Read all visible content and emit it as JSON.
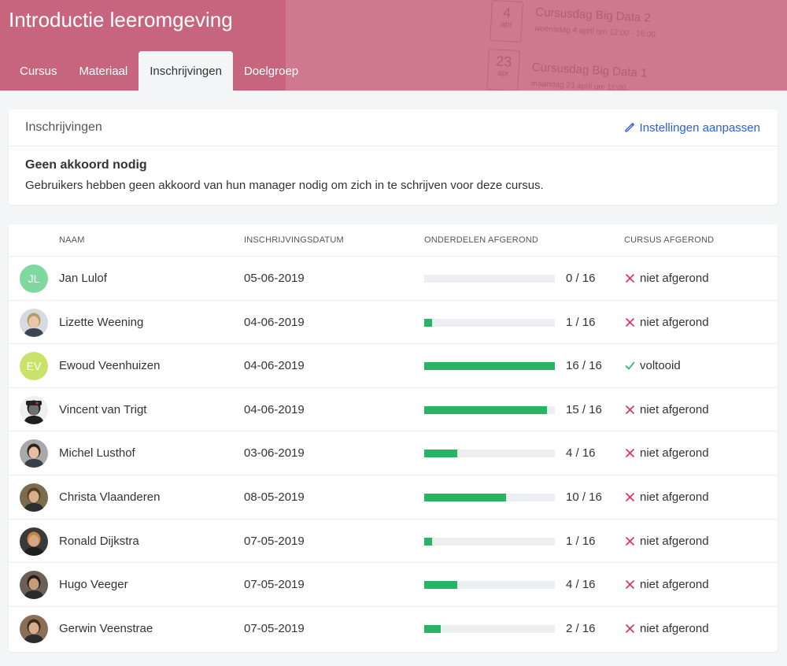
{
  "header": {
    "title": "Introductie leeromgeving",
    "background_events": [
      {
        "day": "4",
        "month": "apr",
        "title": "Cursusdag Big Data 2",
        "subtitle": "woensdag 4 april om 12:00 - 16:00"
      },
      {
        "day": "23",
        "month": "apr",
        "title": "Cursusdag Big Data 1",
        "subtitle": "maandag 23 april om 11:00"
      }
    ],
    "tabs": [
      {
        "label": "Cursus"
      },
      {
        "label": "Materiaal"
      },
      {
        "label": "Inschrijvingen",
        "active": true
      },
      {
        "label": "Doelgroep"
      }
    ]
  },
  "settings": {
    "title": "Inschrijvingen",
    "edit_link": "Instellingen aanpassen",
    "edit_icon": "pencil-icon",
    "heading": "Geen akkoord nodig",
    "text": "Gebruikers hebben geen akkoord van hun manager nodig om zich in te schrijven voor deze cursus."
  },
  "table": {
    "columns": {
      "name": "NAAM",
      "date": "INSCHRIJVINGSDATUM",
      "parts": "ONDERDELEN AFGEROND",
      "done": "CURSUS AFGEROND"
    },
    "rows": [
      {
        "initials": "JL",
        "avatar_color": "#7ed8a0",
        "name": "Jan Lulof",
        "date": "05-06-2019",
        "done": 0,
        "total": 16,
        "count": "0 / 16",
        "status": "niet afgerond",
        "completed": false
      },
      {
        "initials": "",
        "name": "Lizette Weening",
        "date": "04-06-2019",
        "done": 1,
        "total": 16,
        "count": "1 / 16",
        "status": "niet afgerond",
        "completed": false
      },
      {
        "initials": "EV",
        "avatar_color": "#c9e26a",
        "name": "Ewoud Veenhuizen",
        "date": "04-06-2019",
        "done": 16,
        "total": 16,
        "count": "16 / 16",
        "status": "voltooid",
        "completed": true
      },
      {
        "initials": "",
        "name": "Vincent van Trigt",
        "date": "04-06-2019",
        "done": 15,
        "total": 16,
        "count": "15 / 16",
        "status": "niet afgerond",
        "completed": false
      },
      {
        "initials": "",
        "name": "Michel Lusthof",
        "date": "03-06-2019",
        "done": 4,
        "total": 16,
        "count": "4 / 16",
        "status": "niet afgerond",
        "completed": false
      },
      {
        "initials": "",
        "name": "Christa Vlaanderen",
        "date": "08-05-2019",
        "done": 10,
        "total": 16,
        "count": "10 / 16",
        "status": "niet afgerond",
        "completed": false
      },
      {
        "initials": "",
        "name": "Ronald Dijkstra",
        "date": "07-05-2019",
        "done": 1,
        "total": 16,
        "count": "1 / 16",
        "status": "niet afgerond",
        "completed": false
      },
      {
        "initials": "",
        "name": "Hugo Veeger",
        "date": "07-05-2019",
        "done": 4,
        "total": 16,
        "count": "4 / 16",
        "status": "niet afgerond",
        "completed": false
      },
      {
        "initials": "",
        "name": "Gerwin Veenstrae",
        "date": "07-05-2019",
        "done": 2,
        "total": 16,
        "count": "2 / 16",
        "status": "niet afgerond",
        "completed": false
      }
    ]
  },
  "colors": {
    "header": "#c8657e",
    "link": "#2c5fd6",
    "progress": "#27b463",
    "cross": "#e0335c",
    "check": "#27b463"
  }
}
